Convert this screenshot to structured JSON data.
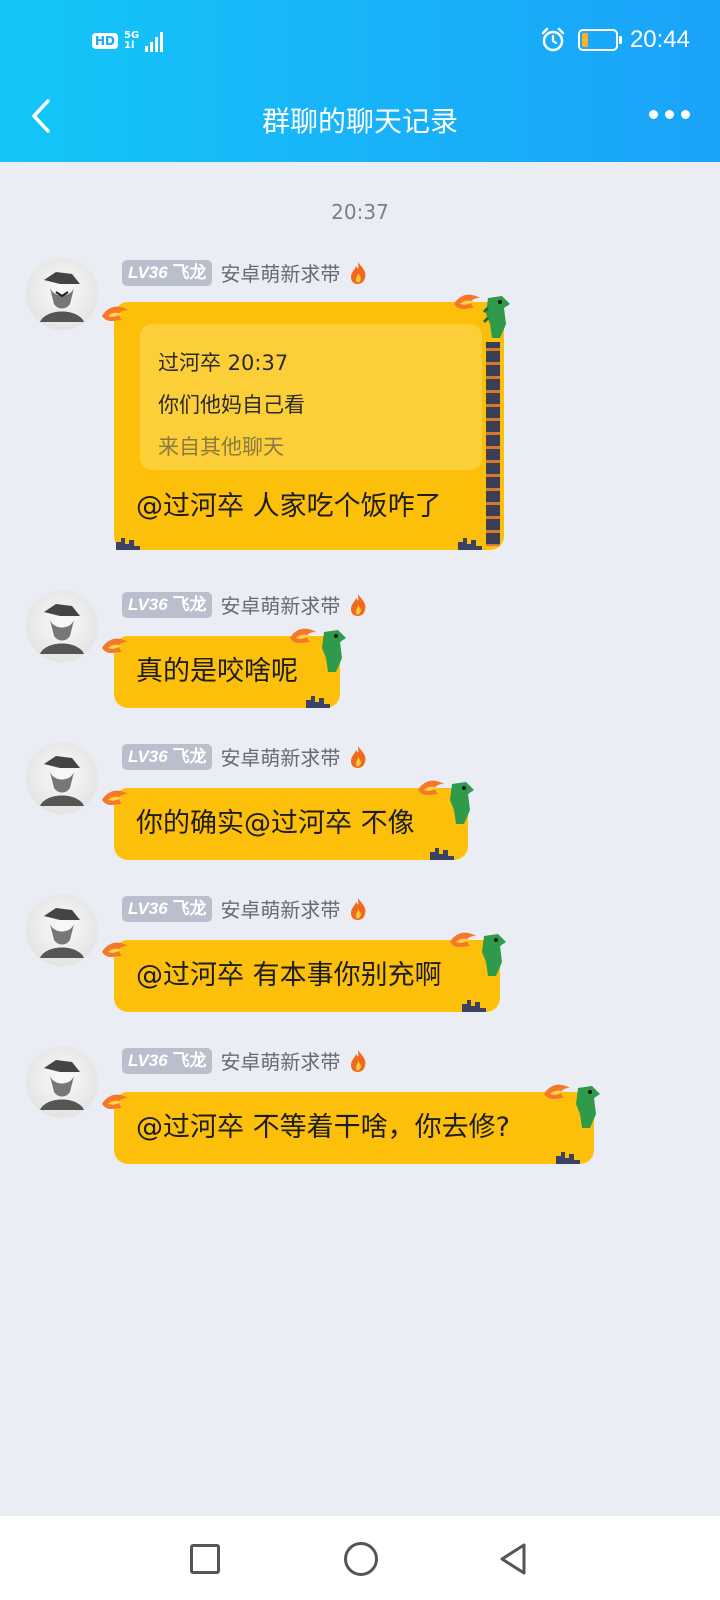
{
  "status_bar": {
    "hd": "HD",
    "network_top": "5G",
    "network_bottom": "1l",
    "time": "20:44",
    "battery_percent": 18,
    "battery_color": "#ffb020"
  },
  "nav": {
    "back_icon": "chevron-left-icon",
    "title": "群聊的聊天记录",
    "more_icon": "more-dots-icon"
  },
  "chat": {
    "timestamp": "20:37",
    "messages": [
      {
        "level": "LV36",
        "name": "飞龙",
        "title": "安卓萌新求带",
        "quote": {
          "header": "过河卒 20:37",
          "body": "你们他妈自己看",
          "source": "来自其他聊天"
        },
        "text": "@过河卒  人家吃个饭咋了"
      },
      {
        "level": "LV36",
        "name": "飞龙",
        "title": "安卓萌新求带",
        "text": "真的是咬啥呢"
      },
      {
        "level": "LV36",
        "name": "飞龙",
        "title": "安卓萌新求带",
        "text": "你的确实@过河卒 不像"
      },
      {
        "level": "LV36",
        "name": "飞龙",
        "title": "安卓萌新求带",
        "text": "@过河卒 有本事你别充啊"
      },
      {
        "level": "LV36",
        "name": "飞龙",
        "title": "安卓萌新求带",
        "text": "@过河卒 不等着干啥，你去修?"
      }
    ]
  },
  "colors": {
    "header_start": "#12c7f8",
    "header_end": "#1aa3f9",
    "bubble": "#fdc00a",
    "background": "#eaedf4"
  },
  "system_nav": {
    "recents_icon": "square-icon",
    "home_icon": "circle-icon",
    "back_icon": "triangle-back-icon"
  }
}
